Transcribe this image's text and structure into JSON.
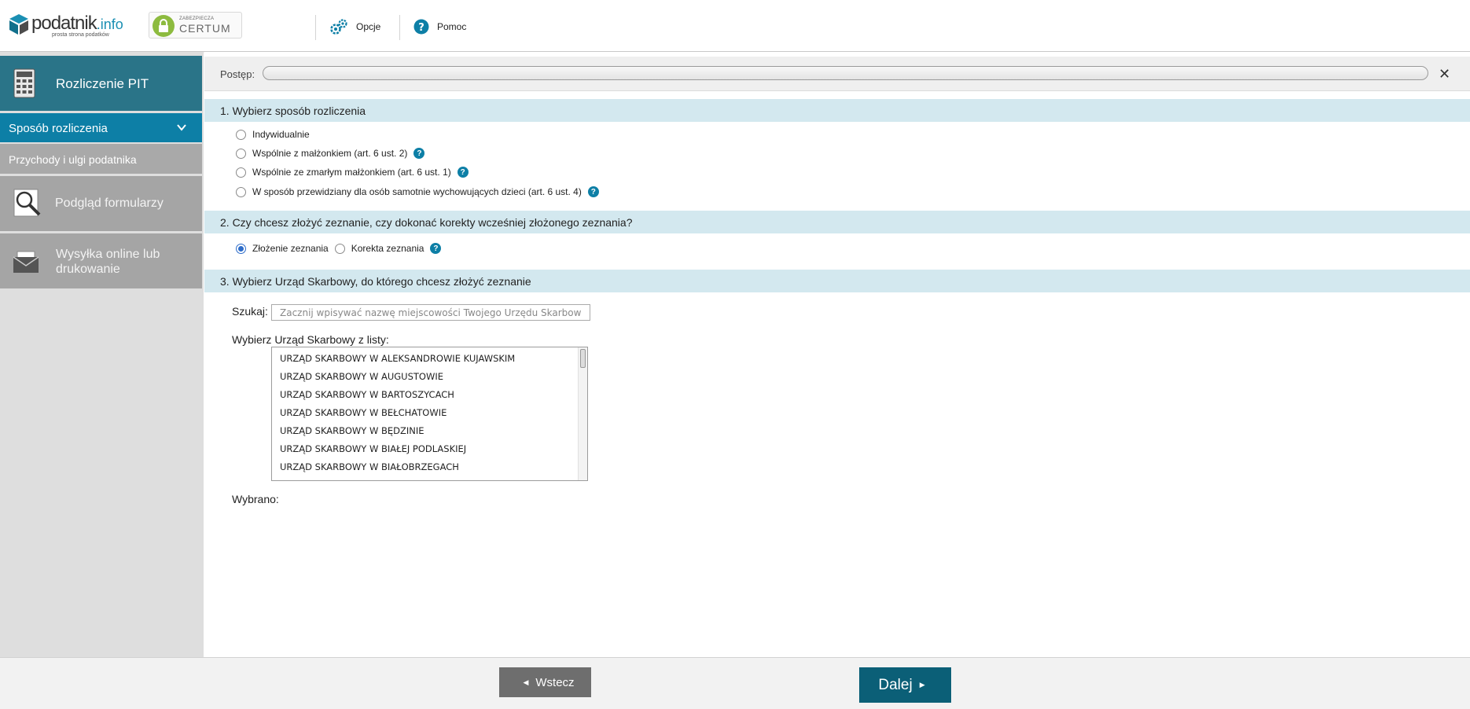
{
  "header": {
    "logo_main": "podatnik",
    "logo_suffix": ".info",
    "logo_tagline": "prosta strona podatków",
    "certum_small": "ZABEZPIECZA",
    "certum_big": "CERTUM",
    "options_label": "Opcje",
    "help_label": "Pomoc"
  },
  "sidebar": {
    "main_label": "Rozliczenie PIT",
    "active_label": "Sposób rozliczenia",
    "sub_label": "Przychody i ulgi podatnika",
    "preview_label": "Podgląd formularzy",
    "send_label": "Wysyłka online lub drukowanie"
  },
  "progress": {
    "label": "Postęp:",
    "value": 0
  },
  "section1": {
    "title": "1. Wybierz sposób rozliczenia",
    "options": [
      "Indywidualnie",
      "Wspólnie z małżonkiem (art. 6 ust. 2)",
      "Wspólnie ze zmarłym małżonkiem (art. 6 ust. 1)",
      "W sposób przewidziany dla osób samotnie wychowujących dzieci (art. 6 ust. 4)"
    ]
  },
  "section2": {
    "title": "2. Czy chcesz złożyć zeznanie, czy dokonać korekty wcześniej złożonego zeznania?",
    "option_filing": "Złożenie zeznania",
    "option_correction": "Korekta zeznania"
  },
  "section3": {
    "title": "3. Wybierz Urząd Skarbowy, do którego chcesz złożyć zeznanie",
    "search_label": "Szukaj:",
    "search_placeholder": "Zacznij wpisywać nazwę miejscowości Twojego Urzędu Skarbowego",
    "list_label": "Wybierz Urząd Skarbowy z listy:",
    "offices": [
      "URZĄD SKARBOWY W ALEKSANDROWIE KUJAWSKIM",
      "URZĄD SKARBOWY W AUGUSTOWIE",
      "URZĄD SKARBOWY W BARTOSZYCACH",
      "URZĄD SKARBOWY W BEŁCHATOWIE",
      "URZĄD SKARBOWY W BĘDZINIE",
      "URZĄD SKARBOWY W BIAŁEJ PODLASKIEJ",
      "URZĄD SKARBOWY W BIAŁOBRZEGACH"
    ],
    "selected_label": "Wybrano:"
  },
  "footer": {
    "back_label": "Wstecz",
    "next_label": "Dalej"
  },
  "colors": {
    "accent": "#0d7fa6",
    "sidebar_main": "#2a7488",
    "section_bg": "#d3e8ef",
    "next_button": "#0b5f77",
    "back_button": "#6e6e6e"
  }
}
